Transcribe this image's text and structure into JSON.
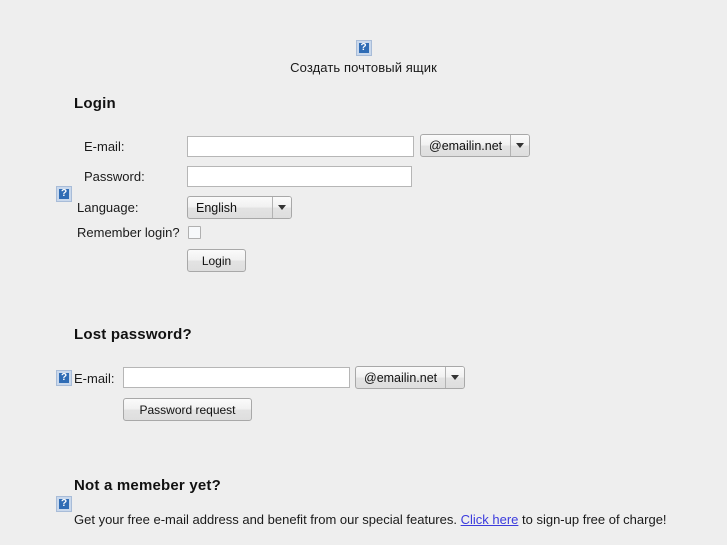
{
  "masthead": {
    "logo_icon": "broken-image-icon",
    "title": "Создать почтовый ящик"
  },
  "login": {
    "heading": "Login",
    "email_label": "E-mail:",
    "email_value": "",
    "email_placeholder": "",
    "domain_value": "@emailin.net",
    "domain_options": [
      "@emailin.net"
    ],
    "password_label": "Password:",
    "password_value": "",
    "help_icon": "broken-image-icon",
    "language_label": "Language:",
    "language_value": "English",
    "language_options": [
      "English"
    ],
    "remember_label": "Remember login?",
    "remember_checked": false,
    "submit_label": "Login"
  },
  "lost_password": {
    "heading": "Lost password?",
    "help_icon": "broken-image-icon",
    "email_label": "E-mail:",
    "email_value": "",
    "domain_value": "@emailin.net",
    "domain_options": [
      "@emailin.net"
    ],
    "submit_label": "Password request"
  },
  "signup": {
    "heading": "Not a memeber yet?",
    "help_icon": "broken-image-icon",
    "text_before": "Get your free e-mail address and benefit from our special features. ",
    "link_label": "Click here",
    "text_after": " to sign-up free of charge!"
  },
  "colors": {
    "page_background": "#eeeeee",
    "link": "#3b3bdd",
    "text": "#1a1a1a",
    "input_border": "#b6b6b6",
    "button_face": "#ededed",
    "broken_icon_blue": "#2f6cb5"
  }
}
